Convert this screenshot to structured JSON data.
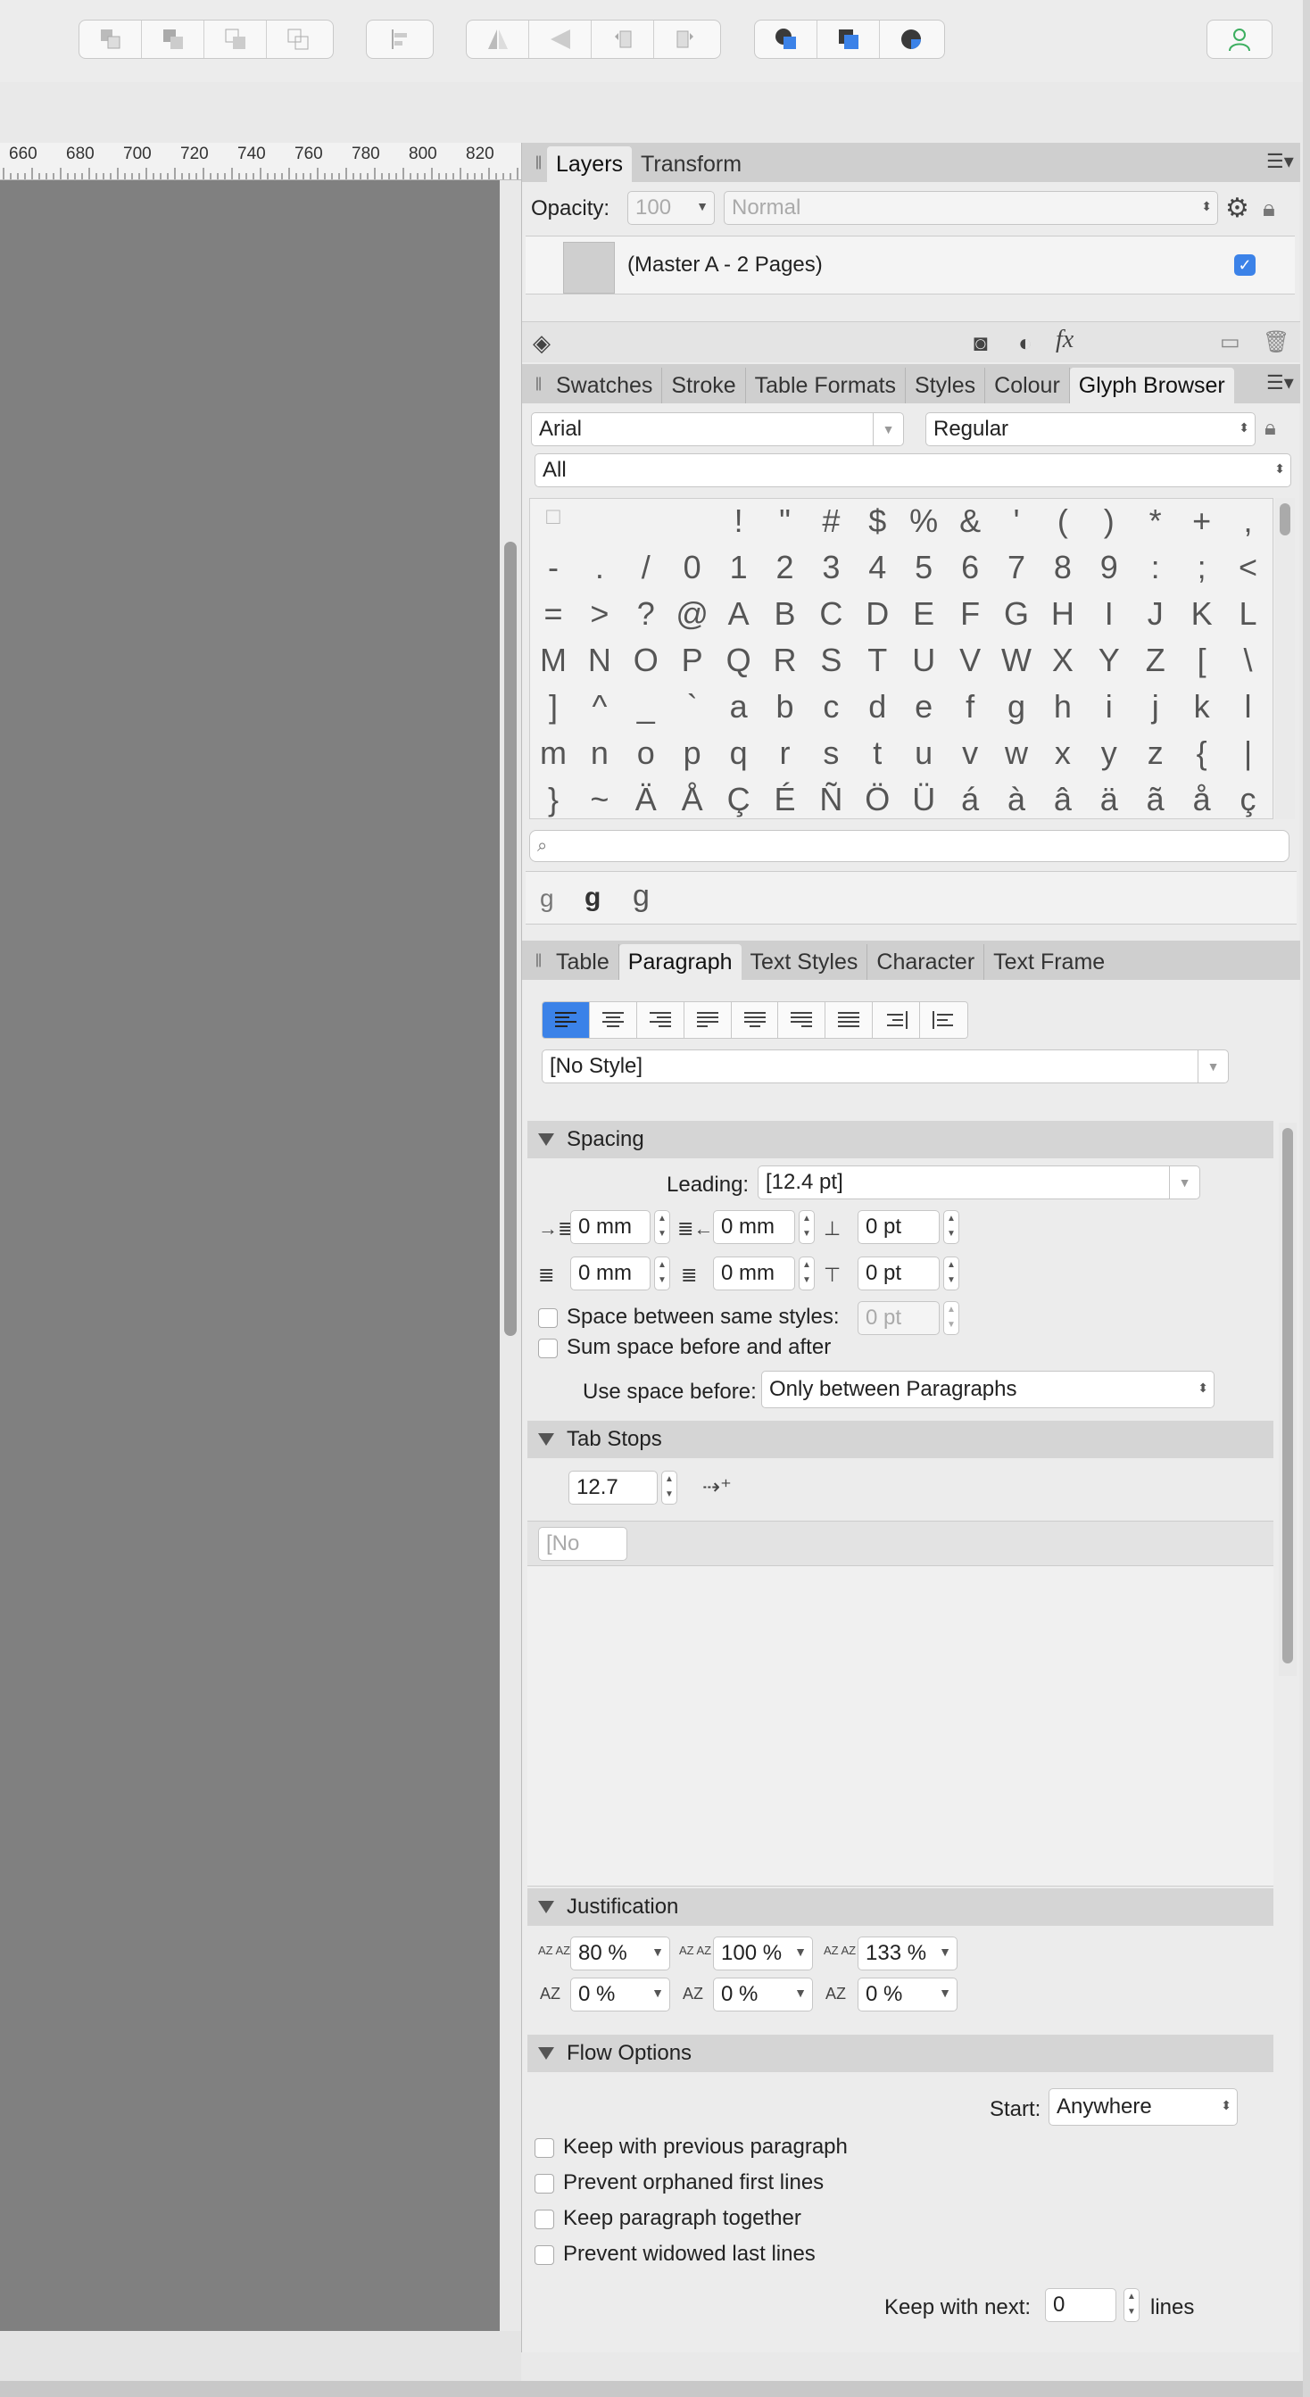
{
  "colors": {
    "accent": "#3b82e8",
    "canvas": "#808080",
    "user_icon": "#3cae5f"
  },
  "ruler": {
    "ticks": [
      "660",
      "680",
      "700",
      "720",
      "740",
      "760",
      "780",
      "800",
      "820"
    ]
  },
  "layers_panel": {
    "tabs": [
      "Layers",
      "Transform"
    ],
    "active_tab": "Layers",
    "opacity_label": "Opacity:",
    "opacity_value": "100",
    "blend_mode": "Normal",
    "layer_name": "(Master A - 2 Pages)",
    "fx_label": "fx"
  },
  "swatch_panel": {
    "tabs": [
      "Swatches",
      "Stroke",
      "Table Formats",
      "Styles",
      "Colour",
      "Glyph Browser"
    ],
    "active_tab": "Glyph Browser",
    "font": "Arial",
    "style": "Regular",
    "range": "All",
    "glyphs": [
      "□",
      "",
      "",
      "",
      "!",
      "\"",
      "#",
      "$",
      "%",
      "&",
      "'",
      "(",
      ")",
      "*",
      "+",
      ",",
      "-",
      ".",
      "/",
      "0",
      "1",
      "2",
      "3",
      "4",
      "5",
      "6",
      "7",
      "8",
      "9",
      ":",
      ";",
      "<",
      "=",
      ">",
      "?",
      "@",
      "A",
      "B",
      "C",
      "D",
      "E",
      "F",
      "G",
      "H",
      "I",
      "J",
      "K",
      "L",
      "M",
      "N",
      "O",
      "P",
      "Q",
      "R",
      "S",
      "T",
      "U",
      "V",
      "W",
      "X",
      "Y",
      "Z",
      "[",
      "\\",
      "]",
      "^",
      "_",
      "`",
      "a",
      "b",
      "c",
      "d",
      "e",
      "f",
      "g",
      "h",
      "i",
      "j",
      "k",
      "l",
      "m",
      "n",
      "o",
      "p",
      "q",
      "r",
      "s",
      "t",
      "u",
      "v",
      "w",
      "x",
      "y",
      "z",
      "{",
      "|",
      "}",
      "~",
      "Ä",
      "Å",
      "Ç",
      "É",
      "Ñ",
      "Ö",
      "Ü",
      "á",
      "à",
      "â",
      "ä",
      "ã",
      "å",
      "ç"
    ],
    "search_placeholder": "",
    "recent_glyphs": [
      "g",
      "g",
      "g"
    ]
  },
  "paragraph_panel": {
    "tabs": [
      "Table",
      "Paragraph",
      "Text Styles",
      "Character",
      "Text Frame"
    ],
    "active_tab": "Paragraph",
    "style_value": "[No Style]",
    "spacing": {
      "title": "Spacing",
      "leading_label": "Leading:",
      "leading_value": "[12.4 pt]",
      "left_indent": "0 mm",
      "first_indent": "0 mm",
      "space_before": "0 pt",
      "right_indent": "0 mm",
      "last_indent": "0 mm",
      "space_after": "0 pt",
      "same_styles_label": "Space between same styles:",
      "same_styles_value": "0 pt",
      "sum_label": "Sum space before and after",
      "use_space_label": "Use space before:",
      "use_space_value": "Only between Paragraphs"
    },
    "tab_stops": {
      "title": "Tab Stops",
      "value": "12.7",
      "list_value": "[No"
    },
    "justification": {
      "title": "Justification",
      "word_min": "80 %",
      "word_desired": "100 %",
      "word_max": "133 %",
      "letter_min": "0 %",
      "letter_desired": "0 %",
      "letter_max": "0 %"
    },
    "flow": {
      "title": "Flow Options",
      "start_label": "Start:",
      "start_value": "Anywhere",
      "opt1": "Keep with previous paragraph",
      "opt2": "Prevent orphaned first lines",
      "opt3": "Keep paragraph together",
      "opt4": "Prevent widowed last lines",
      "keep_next_label": "Keep with next:",
      "keep_next_value": "0",
      "keep_next_unit": "lines"
    }
  }
}
